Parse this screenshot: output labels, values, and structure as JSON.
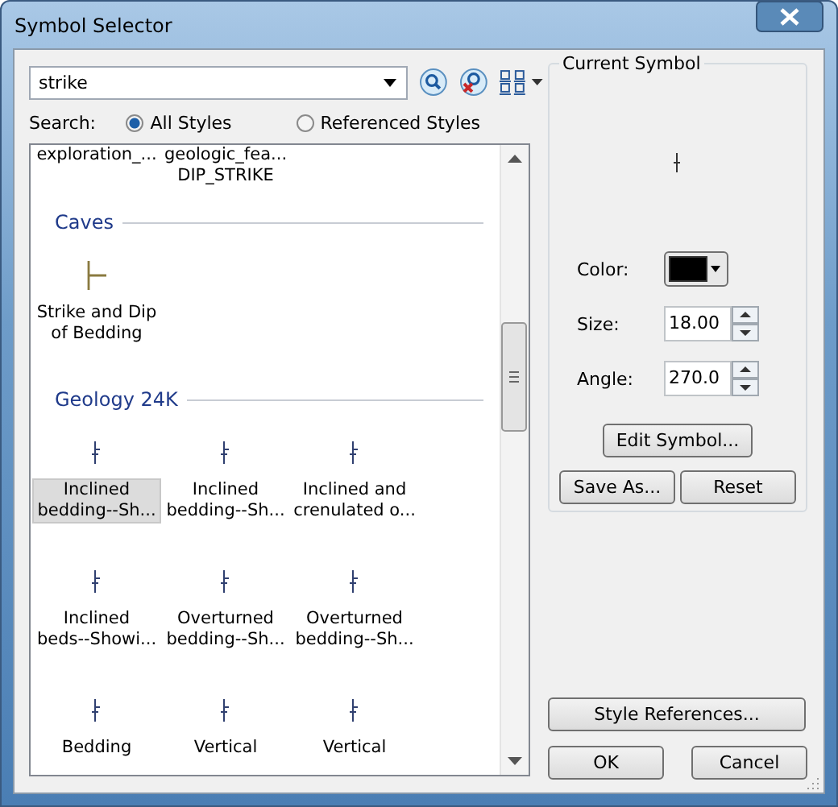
{
  "window": {
    "title": "Symbol Selector"
  },
  "search": {
    "value": "strike"
  },
  "search_scope": {
    "label": "Search:",
    "options": [
      {
        "label": "All Styles",
        "selected": true
      },
      {
        "label": "Referenced Styles",
        "selected": false
      }
    ]
  },
  "gallery": {
    "groups": [
      {
        "items": [
          {
            "label_lines": [
              "exploration_..."
            ],
            "selected": false
          },
          {
            "label_lines": [
              "geologic_fea...",
              "DIP_STRIKE"
            ],
            "selected": false
          }
        ]
      },
      {
        "heading": "Caves",
        "items": [
          {
            "label_lines": [
              "Strike and Dip",
              "of Bedding"
            ],
            "selected": false
          }
        ]
      },
      {
        "heading": "Geology 24K",
        "items": [
          {
            "label_lines": [
              "Inclined",
              "bedding--Sh..."
            ],
            "selected": true
          },
          {
            "label_lines": [
              "Inclined",
              "bedding--Sh..."
            ],
            "selected": false
          },
          {
            "label_lines": [
              "Inclined and",
              "crenulated o..."
            ],
            "selected": false
          },
          {
            "label_lines": [
              "Inclined",
              "beds--Showi..."
            ],
            "selected": false
          },
          {
            "label_lines": [
              "Overturned",
              "bedding--Sh..."
            ],
            "selected": false
          },
          {
            "label_lines": [
              "Overturned",
              "bedding--Sh..."
            ],
            "selected": false
          },
          {
            "label_lines": [
              "Bedding"
            ],
            "selected": false
          },
          {
            "label_lines": [
              "Vertical"
            ],
            "selected": false
          },
          {
            "label_lines": [
              "Vertical"
            ],
            "selected": false
          }
        ]
      }
    ]
  },
  "current_symbol": {
    "title": "Current Symbol",
    "color": {
      "label": "Color:",
      "color": "#000000"
    },
    "size": {
      "label": "Size:",
      "value": "18.00"
    },
    "angle": {
      "label": "Angle:",
      "value": "270.0"
    },
    "edit_button": "Edit Symbol...",
    "buttons": [
      "Save As...",
      "Reset"
    ]
  },
  "style_references_button": "Style References...",
  "buttons": [
    "OK",
    "Cancel"
  ]
}
